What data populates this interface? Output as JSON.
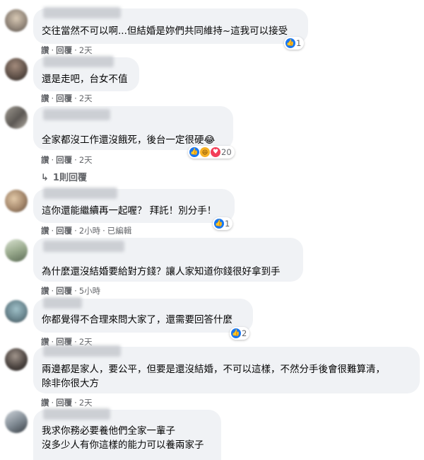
{
  "comments": [
    {
      "text": [
        "交往當然不可以啊...但結婚是妳們共同維持~這我可以接受"
      ],
      "meta": {
        "like": "讚",
        "reply": "回覆",
        "time": "2天",
        "edited": ""
      },
      "reaction_count": "1"
    },
    {
      "text": [
        "還是走吧，台女不值"
      ],
      "meta": {
        "like": "讚",
        "reply": "回覆",
        "time": "2天",
        "edited": ""
      },
      "reaction_count": ""
    },
    {
      "text": [
        "全家都沒工作還沒餓死，後台一定很硬😂"
      ],
      "meta": {
        "like": "讚",
        "reply": "回覆",
        "time": "2天",
        "edited": ""
      },
      "reaction_count": "20"
    },
    {
      "text": [
        "這你還能繼續再一起喔？ 拜託！別分手！"
      ],
      "meta": {
        "like": "讚",
        "reply": "回覆",
        "time": "2小時",
        "edited": "已編輯"
      },
      "reaction_count": "1"
    },
    {
      "text": [
        "為什麼還沒結婚要給對方錢？讓人家知道你錢很好拿到手"
      ],
      "meta": {
        "like": "讚",
        "reply": "回覆",
        "time": "5小時",
        "edited": ""
      },
      "reaction_count": ""
    },
    {
      "text": [
        "你都覺得不合理來問大家了，還需要回答什麼"
      ],
      "meta": {
        "like": "讚",
        "reply": "回覆",
        "time": "2天",
        "edited": ""
      },
      "reaction_count": "2"
    },
    {
      "text": [
        "兩邊都是家人，要公平，但要是還沒結婚，不可以這樣，不然分手後會很難算清，",
        "除非你很大方"
      ],
      "meta": {
        "like": "讚",
        "reply": "回覆",
        "time": "2天",
        "edited": ""
      },
      "reaction_count": ""
    },
    {
      "text": [
        "我求你務必要養他們全家一輩子",
        "沒多少人有你這樣的能力可以養兩家子"
      ],
      "meta": {
        "like": "",
        "reply": "",
        "time": "",
        "edited": ""
      },
      "reaction_count": ""
    }
  ],
  "replies_link": "1則回覆",
  "icons": {
    "like": "like-icon",
    "haha": "haha-icon",
    "love": "love-icon",
    "reply_arrow": "reply-arrow-icon"
  }
}
